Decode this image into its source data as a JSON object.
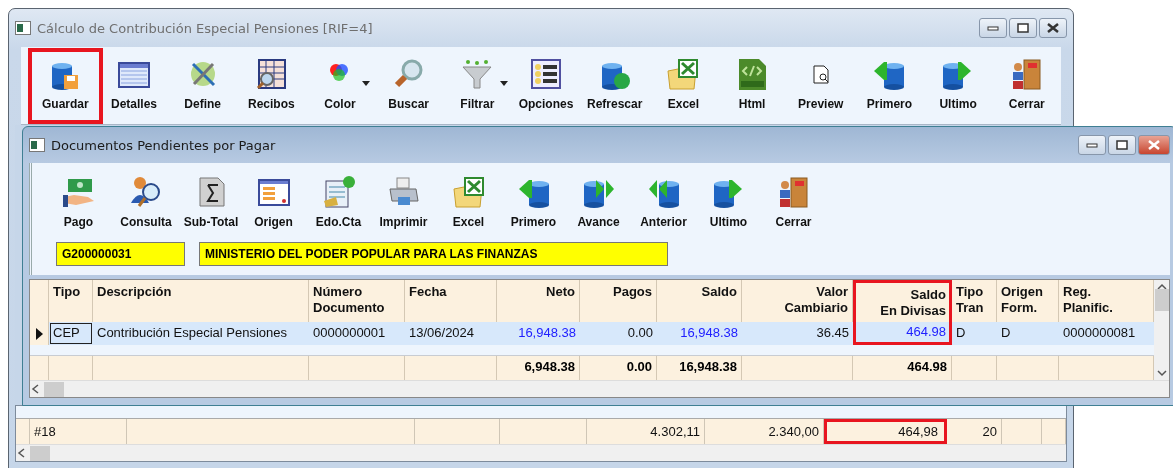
{
  "main_window": {
    "title": "Cálculo de Contribución Especial Pensiones [RIF=4]",
    "active": false,
    "toolbar": [
      {
        "label": "Guardar",
        "highlighted": true,
        "dropdown": false
      },
      {
        "label": "Detalles",
        "highlighted": false,
        "dropdown": false
      },
      {
        "label": "Define",
        "highlighted": false,
        "dropdown": false
      },
      {
        "label": "Recibos",
        "highlighted": false,
        "dropdown": false
      },
      {
        "label": "Color",
        "highlighted": false,
        "dropdown": true
      },
      {
        "label": "Buscar",
        "highlighted": false,
        "dropdown": false
      },
      {
        "label": "Filtrar",
        "highlighted": false,
        "dropdown": true
      },
      {
        "label": "Opciones",
        "highlighted": false,
        "dropdown": false
      },
      {
        "label": "Refrescar",
        "highlighted": false,
        "dropdown": false
      },
      {
        "label": "Excel",
        "highlighted": false,
        "dropdown": false
      },
      {
        "label": "Html",
        "highlighted": false,
        "dropdown": false
      },
      {
        "label": "Preview",
        "highlighted": false,
        "dropdown": false
      },
      {
        "label": "Primero",
        "highlighted": false,
        "dropdown": false
      },
      {
        "label": "Ultimo",
        "highlighted": false,
        "dropdown": false
      },
      {
        "label": "Cerrar",
        "highlighted": false,
        "dropdown": false
      }
    ],
    "footer_row": [
      {
        "text": "#18",
        "highlighted": false
      },
      {
        "text": "4.302,11",
        "highlighted": false
      },
      {
        "text": "2.340,00",
        "highlighted": false
      },
      {
        "text": "464,98",
        "highlighted": true
      },
      {
        "text": "20",
        "highlighted": false
      }
    ]
  },
  "child_window": {
    "title": "Documentos Pendientes por Pagar",
    "active": true,
    "toolbar": [
      {
        "label": "Pago"
      },
      {
        "label": "Consulta"
      },
      {
        "label": "Sub-Total"
      },
      {
        "label": "Origen"
      },
      {
        "label": "Edo.Cta"
      },
      {
        "label": "Imprimir"
      },
      {
        "label": "Excel"
      },
      {
        "label": "Primero"
      },
      {
        "label": "Avance"
      },
      {
        "label": "Anterior"
      },
      {
        "label": "Ultimo"
      },
      {
        "label": "Cerrar"
      }
    ],
    "code_field": "G200000031",
    "name_field": "MINISTERIO DEL PODER POPULAR PARA LAS FINANZAS",
    "table": {
      "columns": [
        {
          "label": "Tipo",
          "highlighted": false
        },
        {
          "label": "Descripción",
          "highlighted": false
        },
        {
          "label": "Número\nDocumento",
          "highlighted": false
        },
        {
          "label": "Fecha",
          "highlighted": false
        },
        {
          "label": "Neto",
          "highlighted": false,
          "total": "6,948.38"
        },
        {
          "label": "Pagos",
          "highlighted": false,
          "total": "0.00"
        },
        {
          "label": "Saldo",
          "highlighted": false,
          "total": "16,948.38"
        },
        {
          "label": "Valor\nCambiario",
          "highlighted": false
        },
        {
          "label": "Saldo\nEn Divisas",
          "highlighted": true,
          "total": "464.98"
        },
        {
          "label": "Tipo\nTran",
          "highlighted": false
        },
        {
          "label": "Origen\nForm.",
          "highlighted": false
        },
        {
          "label": "Reg.\nPlanific.",
          "highlighted": false
        }
      ],
      "rows": [
        {
          "selected": true,
          "cells": [
            {
              "text": "CEP",
              "focused": true,
              "linked": false
            },
            {
              "text": "Contribución Especial Pensiones",
              "focused": false,
              "linked": false
            },
            {
              "text": "0000000001",
              "focused": false,
              "linked": false
            },
            {
              "text": "13/06/2024",
              "focused": false,
              "linked": false
            },
            {
              "text": "16,948.38",
              "focused": false,
              "linked": true
            },
            {
              "text": "0.00",
              "focused": false,
              "linked": false
            },
            {
              "text": "16,948.38",
              "focused": false,
              "linked": true
            },
            {
              "text": "36.45",
              "focused": false,
              "linked": false
            },
            {
              "text": "464.98",
              "focused": false,
              "linked": true
            },
            {
              "text": "D",
              "focused": false,
              "linked": false
            },
            {
              "text": "D",
              "focused": false,
              "linked": false
            },
            {
              "text": "0000000081",
              "focused": false,
              "linked": false
            }
          ]
        }
      ]
    }
  }
}
